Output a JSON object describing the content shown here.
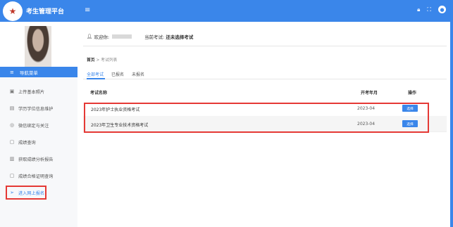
{
  "app": {
    "title": "考生管理平台"
  },
  "topbar": {
    "menu_icon": "hamburger-icon",
    "icons": [
      "lock-icon",
      "fullscreen-icon",
      "user-icon"
    ]
  },
  "sidebar": {
    "nav_header": "导航菜单",
    "items": [
      {
        "label": "上传基本照片",
        "icon": "image-icon"
      },
      {
        "label": "学历学位信息维护",
        "icon": "book-icon"
      },
      {
        "label": "微信绑定与关注",
        "icon": "wechat-icon"
      },
      {
        "label": "成绩查询",
        "icon": "file-icon"
      },
      {
        "label": "获取成绩分析报告",
        "icon": "report-icon"
      },
      {
        "label": "成绩合格证明查询",
        "icon": "certificate-icon"
      },
      {
        "label": "进入网上报名",
        "icon": "send-icon",
        "active": true
      }
    ]
  },
  "header": {
    "welcome_label": "欢迎你:",
    "current_exam_label": "当前考试:",
    "current_exam_value": "还未选择考试"
  },
  "breadcrumb": {
    "home": "首页",
    "separator": ">",
    "current": "考试列表"
  },
  "tabs": [
    "全部考试",
    "已报名",
    "未报名"
  ],
  "table": {
    "columns": [
      "考试名称",
      "开考年月",
      "操作"
    ],
    "rows": [
      {
        "name": "2023年护士执业资格考试",
        "date": "2023-04",
        "action": "选择"
      },
      {
        "name": "2023年卫生专业技术资格考试",
        "date": "2023-04",
        "action": "选择"
      }
    ]
  },
  "colors": {
    "primary": "#3a86ea",
    "highlight": "#e53935"
  }
}
